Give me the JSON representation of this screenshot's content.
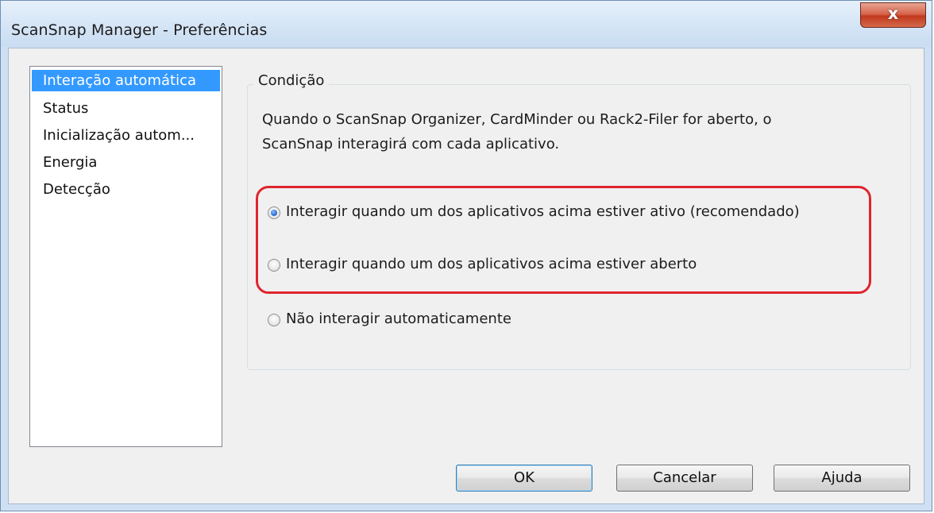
{
  "window": {
    "title": "ScanSnap Manager - Preferências",
    "close_icon": "x"
  },
  "sidebar": {
    "items": [
      {
        "label": "Interação automática",
        "selected": true
      },
      {
        "label": "Status",
        "selected": false
      },
      {
        "label": "Inicialização autom...",
        "selected": false
      },
      {
        "label": "Energia",
        "selected": false
      },
      {
        "label": "Detecção",
        "selected": false
      }
    ]
  },
  "condition": {
    "group_label": "Condição",
    "description_line1": "Quando o ScanSnap Organizer, CardMinder ou Rack2-Filer for aberto, o",
    "description_line2": "ScanSnap interagirá com cada aplicativo.",
    "options": [
      {
        "label": "Interagir quando um dos aplicativos acima estiver ativo (recomendado)",
        "checked": true
      },
      {
        "label": "Interagir quando um dos aplicativos acima estiver aberto",
        "checked": false
      },
      {
        "label": "Não interagir automaticamente",
        "checked": false
      }
    ]
  },
  "buttons": {
    "ok": "OK",
    "cancel": "Cancelar",
    "help": "Ajuda"
  },
  "colors": {
    "selection": "#3399ff",
    "highlight_border": "#e0242d"
  }
}
